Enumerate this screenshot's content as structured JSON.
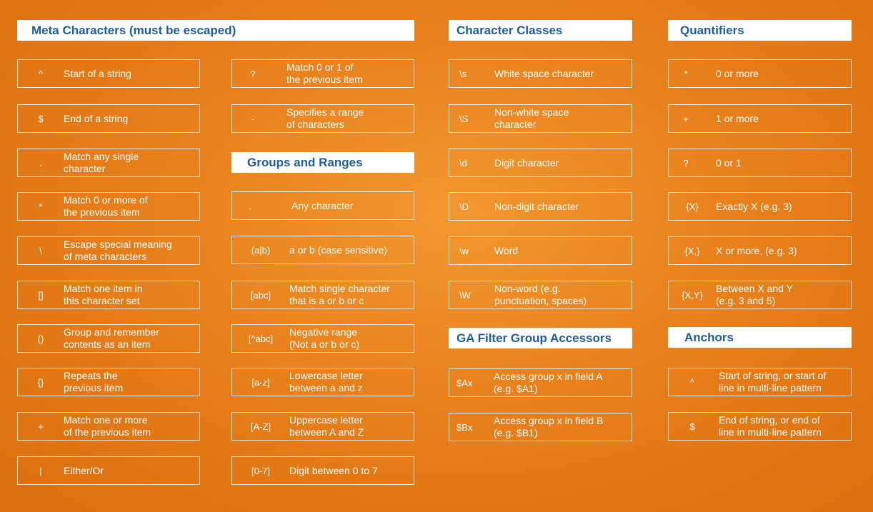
{
  "meta": {
    "header": "Meta Characters (must be escaped)",
    "items": [
      {
        "symbol": "^",
        "desc": "Start of a string"
      },
      {
        "symbol": "$",
        "desc": "End of a string"
      },
      {
        "symbol": ".",
        "desc": "Match any single\ncharacter"
      },
      {
        "symbol": "*",
        "desc": "Match 0 or more of\nthe previous item"
      },
      {
        "symbol": "\\",
        "desc": "Escape special meaning\nof meta characters"
      },
      {
        "symbol": "[]",
        "desc": "Match one item in\nthis character set"
      },
      {
        "symbol": "()",
        "desc": "Group and remember\ncontents as an item"
      },
      {
        "symbol": "{}",
        "desc": "Repeats the\nprevious item"
      },
      {
        "symbol": "+",
        "desc": "Match one or more\nof the previous item"
      },
      {
        "symbol": "|",
        "desc": "Either/Or"
      }
    ],
    "items2": [
      {
        "symbol": "?",
        "desc": "Match 0 or 1 of\nthe previous item"
      },
      {
        "symbol": "-",
        "desc": "Specifies a range\nof characters"
      }
    ]
  },
  "groups": {
    "header": "Groups and Ranges",
    "items": [
      {
        "symbol": ".",
        "desc": "Any character"
      },
      {
        "symbol": "(a|b)",
        "desc": "a or b (case sensitive)"
      },
      {
        "symbol": "[abc]",
        "desc": "Match single character\nthat is a or b or c"
      },
      {
        "symbol": "[^abc]",
        "desc": "Negative range\n(Not a or b or c)"
      },
      {
        "symbol": "[a-z]",
        "desc": "Lowercase letter\nbetween a and z"
      },
      {
        "symbol": "[A-Z]",
        "desc": "Uppercase letter\nbetween A and Z"
      },
      {
        "symbol": "[0-7]",
        "desc": "Digit between 0 to 7"
      }
    ]
  },
  "classes": {
    "header": "Character Classes",
    "items": [
      {
        "symbol": "\\s",
        "desc": "White space character"
      },
      {
        "symbol": "\\S",
        "desc": "Non-white space\ncharacter"
      },
      {
        "symbol": "\\d",
        "desc": "Digit character"
      },
      {
        "symbol": "\\D",
        "desc": "Non-digit character"
      },
      {
        "symbol": "\\w",
        "desc": "Word"
      },
      {
        "symbol": "\\W",
        "desc": "Non-word (e.g.\npunctuation, spaces)"
      }
    ]
  },
  "ga": {
    "header": "GA Filter Group Accessors",
    "items": [
      {
        "symbol": "$Ax",
        "desc": "Access group x in field A\n(e.g. $A1)"
      },
      {
        "symbol": "$Bx",
        "desc": "Access group x in field B\n(e.g. $B1)"
      }
    ]
  },
  "quantifiers": {
    "header": "Quantifiers",
    "items": [
      {
        "symbol": "*",
        "desc": "0 or more"
      },
      {
        "symbol": "+",
        "desc": "1 or more"
      },
      {
        "symbol": "?",
        "desc": "0 or 1"
      },
      {
        "symbol": "{X}",
        "desc": "Exactly X (e.g. 3)"
      },
      {
        "symbol": "{X,}",
        "desc": "X or more, (e.g. 3)"
      },
      {
        "symbol": "{X,Y}",
        "desc": "Between X and Y\n(e.g. 3 and 5)"
      }
    ]
  },
  "anchors": {
    "header": "Anchors",
    "items": [
      {
        "symbol": "^",
        "desc": "Start of string, or start of\nline in multi-line pattern"
      },
      {
        "symbol": "$",
        "desc": "End of string, or end of\nline in multi-line pattern"
      }
    ]
  }
}
